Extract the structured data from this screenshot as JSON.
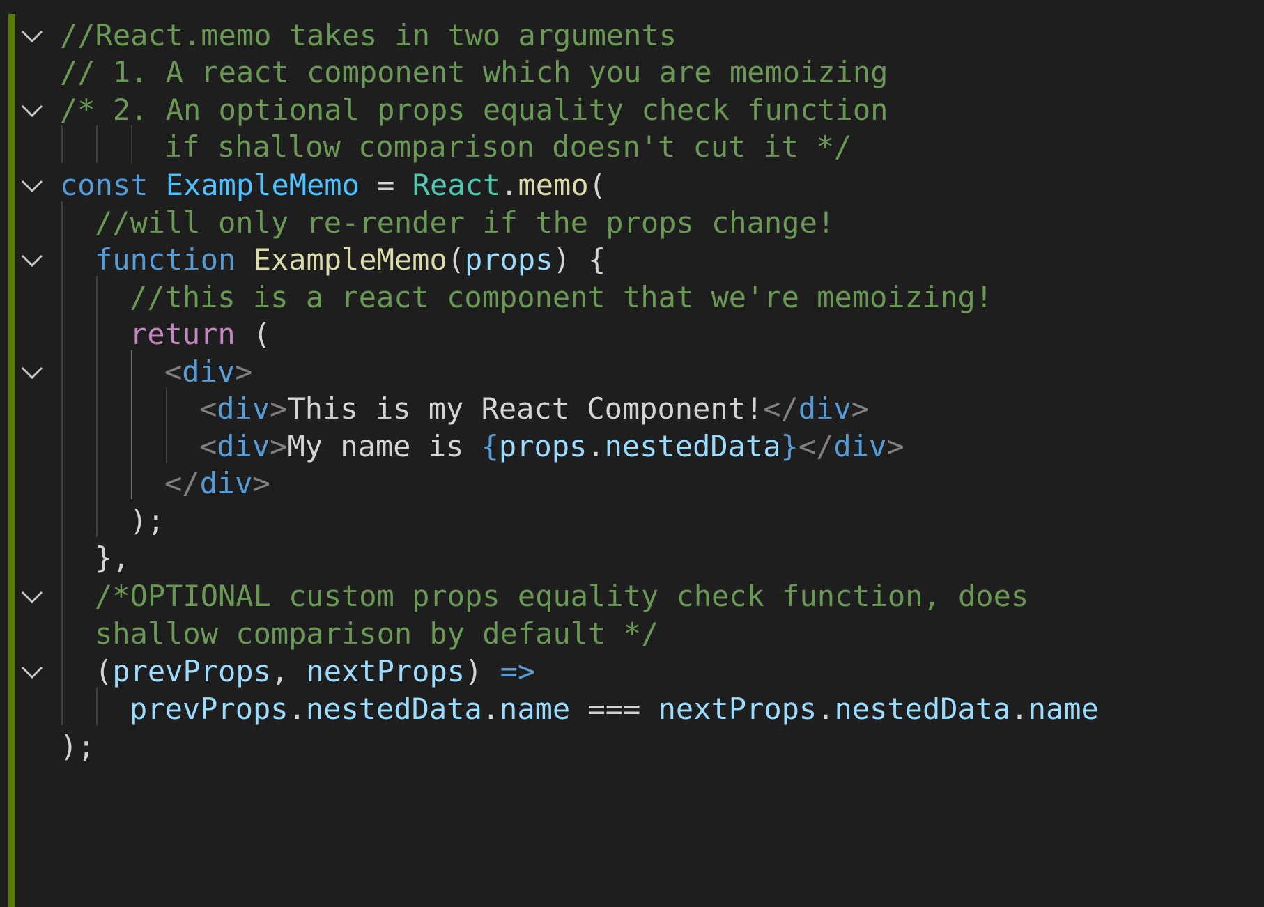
{
  "editor": {
    "language": "javascript",
    "theme": "dark",
    "colors": {
      "background": "#1e1e1e",
      "git_added_bar": "#587c0c",
      "comment": "#6a9955",
      "keyword": "#569cd6",
      "control": "#c586c0",
      "variable": "#4fc1ff",
      "property": "#9cdcfe",
      "function": "#dcdcaa",
      "type": "#4ec9b0",
      "text": "#d4d4d4"
    },
    "fold_icon": "chevron-down-icon",
    "lines": [
      {
        "fold": true,
        "tokens": [
          {
            "t": "//React.memo takes in two arguments",
            "k": "comment"
          }
        ]
      },
      {
        "fold": false,
        "tokens": [
          {
            "t": "// 1. A react component which you are memoizing",
            "k": "comment"
          }
        ]
      },
      {
        "fold": true,
        "tokens": [
          {
            "t": "/* 2. An optional props equality check function",
            "k": "comment"
          }
        ]
      },
      {
        "fold": false,
        "tokens": [
          {
            "t": "if shallow comparison doesn't cut it */",
            "k": "comment"
          }
        ]
      },
      {
        "fold": true,
        "tokens": [
          {
            "t": "const",
            "k": "kw"
          },
          {
            "t": " ",
            "k": "text"
          },
          {
            "t": "ExampleMemo",
            "k": "var"
          },
          {
            "t": " = ",
            "k": "text"
          },
          {
            "t": "React",
            "k": "type"
          },
          {
            "t": ".",
            "k": "text"
          },
          {
            "t": "memo",
            "k": "fn"
          },
          {
            "t": "(",
            "k": "text"
          }
        ]
      },
      {
        "fold": false,
        "tokens": [
          {
            "t": "//will only re-render if the props change!",
            "k": "comment"
          }
        ]
      },
      {
        "fold": true,
        "tokens": [
          {
            "t": "function",
            "k": "kw"
          },
          {
            "t": " ",
            "k": "text"
          },
          {
            "t": "ExampleMemo",
            "k": "fn"
          },
          {
            "t": "(",
            "k": "text"
          },
          {
            "t": "props",
            "k": "prop"
          },
          {
            "t": ") {",
            "k": "text"
          }
        ]
      },
      {
        "fold": false,
        "tokens": [
          {
            "t": "//this is a react component that we're memoizing!",
            "k": "comment"
          }
        ]
      },
      {
        "fold": false,
        "tokens": [
          {
            "t": "return",
            "k": "ctrl"
          },
          {
            "t": " (",
            "k": "text"
          }
        ]
      },
      {
        "fold": true,
        "tokens": [
          {
            "t": "<",
            "k": "punct"
          },
          {
            "t": "div",
            "k": "tag"
          },
          {
            "t": ">",
            "k": "punct"
          }
        ]
      },
      {
        "fold": false,
        "tokens": [
          {
            "t": "<",
            "k": "punct"
          },
          {
            "t": "div",
            "k": "tag"
          },
          {
            "t": ">",
            "k": "punct"
          },
          {
            "t": "This is my React Component!",
            "k": "text"
          },
          {
            "t": "</",
            "k": "punct"
          },
          {
            "t": "div",
            "k": "tag"
          },
          {
            "t": ">",
            "k": "punct"
          }
        ]
      },
      {
        "fold": false,
        "tokens": [
          {
            "t": "<",
            "k": "punct"
          },
          {
            "t": "div",
            "k": "tag"
          },
          {
            "t": ">",
            "k": "punct"
          },
          {
            "t": "My name is ",
            "k": "text"
          },
          {
            "t": "{",
            "k": "brace"
          },
          {
            "t": "props",
            "k": "prop"
          },
          {
            "t": ".",
            "k": "text"
          },
          {
            "t": "nestedData",
            "k": "prop"
          },
          {
            "t": "}",
            "k": "brace"
          },
          {
            "t": "</",
            "k": "punct"
          },
          {
            "t": "div",
            "k": "tag"
          },
          {
            "t": ">",
            "k": "punct"
          }
        ]
      },
      {
        "fold": false,
        "tokens": [
          {
            "t": "</",
            "k": "punct"
          },
          {
            "t": "div",
            "k": "tag"
          },
          {
            "t": ">",
            "k": "punct"
          }
        ]
      },
      {
        "fold": false,
        "tokens": [
          {
            "t": ");",
            "k": "text"
          }
        ]
      },
      {
        "fold": false,
        "tokens": [
          {
            "t": "},",
            "k": "text"
          }
        ]
      },
      {
        "fold": true,
        "tokens": [
          {
            "t": "/*OPTIONAL custom props equality check function, does",
            "k": "comment"
          }
        ]
      },
      {
        "fold": false,
        "tokens": [
          {
            "t": "shallow comparison by default */",
            "k": "comment"
          }
        ]
      },
      {
        "fold": true,
        "tokens": [
          {
            "t": "(",
            "k": "text"
          },
          {
            "t": "prevProps",
            "k": "prop"
          },
          {
            "t": ", ",
            "k": "text"
          },
          {
            "t": "nextProps",
            "k": "prop"
          },
          {
            "t": ") ",
            "k": "text"
          },
          {
            "t": "=>",
            "k": "kw"
          }
        ]
      },
      {
        "fold": false,
        "tokens": [
          {
            "t": "prevProps",
            "k": "prop"
          },
          {
            "t": ".",
            "k": "text"
          },
          {
            "t": "nestedData",
            "k": "prop"
          },
          {
            "t": ".",
            "k": "text"
          },
          {
            "t": "name",
            "k": "prop"
          },
          {
            "t": " === ",
            "k": "text"
          },
          {
            "t": "nextProps",
            "k": "prop"
          },
          {
            "t": ".",
            "k": "text"
          },
          {
            "t": "nestedData",
            "k": "prop"
          },
          {
            "t": ".",
            "k": "text"
          },
          {
            "t": "name",
            "k": "prop"
          }
        ]
      },
      {
        "fold": false,
        "tokens": [
          {
            "t": ");",
            "k": "text"
          }
        ]
      }
    ]
  }
}
